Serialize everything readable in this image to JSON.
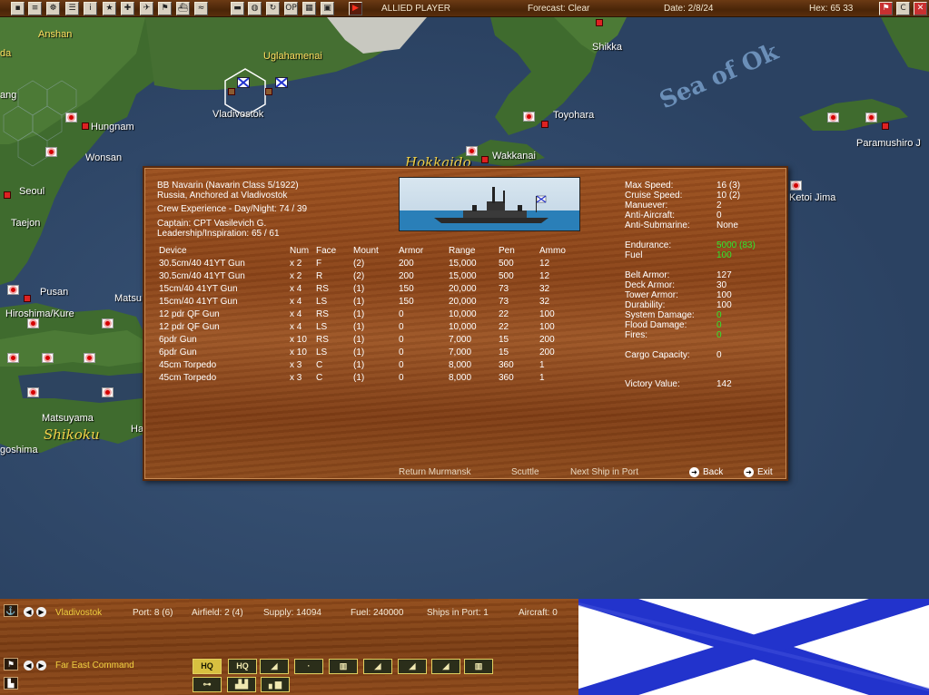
{
  "topbar": {
    "buttons": [
      "save",
      "report",
      "globe",
      "list",
      "info",
      "star",
      "plus",
      "plane",
      "flag",
      "ship",
      "wave",
      "tank",
      "earth",
      "replay",
      "op",
      "calc",
      "screen",
      "end"
    ],
    "button_glyphs": [
      "▪",
      "≡",
      "☸",
      "☰",
      "i",
      "★",
      "✚",
      "✈",
      "⚑",
      "⛴",
      "≈",
      "▬",
      "◍",
      "↻",
      "OP",
      "▦",
      "▣",
      "▶"
    ],
    "player": "ALLIED PLAYER",
    "forecast": "Forecast: Clear",
    "date": "Date: 2/8/24",
    "hex": "Hex: 65 33",
    "right_buttons": [
      "⚑",
      "C",
      "✕"
    ]
  },
  "map": {
    "labels": {
      "anshan": "Anshan",
      "da": "da",
      "yang": "ang",
      "hungnam": "Hungnam",
      "wonsan": "Wonsan",
      "seoul": "Seoul",
      "taejon": "Taejon",
      "pusan": "Pusan",
      "matsu": "Matsu",
      "hiroshima": "Hiroshima/Kure",
      "matsuyama": "Matsuyama",
      "goshima": "goshima",
      "uglahamenai": "Uglahamenai",
      "vladivostok": "Vladivostok",
      "shikka": "Shikka",
      "toyohara": "Toyohara",
      "wakkanai": "Wakkanai",
      "paramushiro": "Paramushiro J",
      "ketoi": "Ketoi Jima",
      "ha": "Ha"
    },
    "regions": {
      "hokkaido": "Hokkaido",
      "shikoku": "Shikoku",
      "sea_of_okhotsk": "Sea of Ok"
    }
  },
  "dialog": {
    "ship_title": "BB Navarin (Navarin Class 5/1922)",
    "ship_status": "Russia, Anchored at Vladivostok",
    "crew": "Crew Experience - Day/Night: 74 / 39",
    "captain": "Captain: CPT Vasilevich G.",
    "leadership": "Leadership/Inspiration: 65 / 61",
    "device_headers": [
      "Device",
      "Num",
      "Face",
      "Mount",
      "Armor",
      "Range",
      "Pen",
      "Ammo"
    ],
    "devices": [
      [
        "30.5cm/40 41YT Gun",
        "x 2",
        "F",
        "(2)",
        "200",
        "15,000",
        "500",
        "12"
      ],
      [
        "30.5cm/40 41YT Gun",
        "x 2",
        "R",
        "(2)",
        "200",
        "15,000",
        "500",
        "12"
      ],
      [
        "15cm/40 41YT Gun",
        "x 4",
        "RS",
        "(1)",
        "150",
        "20,000",
        "73",
        "32"
      ],
      [
        "15cm/40 41YT Gun",
        "x 4",
        "LS",
        "(1)",
        "150",
        "20,000",
        "73",
        "32"
      ],
      [
        "12 pdr QF Gun",
        "x 4",
        "RS",
        "(1)",
        "0",
        "10,000",
        "22",
        "100"
      ],
      [
        "12 pdr QF Gun",
        "x 4",
        "LS",
        "(1)",
        "0",
        "10,000",
        "22",
        "100"
      ],
      [
        "6pdr Gun",
        "x 10",
        "RS",
        "(1)",
        "0",
        "7,000",
        "15",
        "200"
      ],
      [
        "6pdr Gun",
        "x 10",
        "LS",
        "(1)",
        "0",
        "7,000",
        "15",
        "200"
      ],
      [
        "45cm Torpedo",
        "x 3",
        "C",
        "(1)",
        "0",
        "8,000",
        "360",
        "1"
      ],
      [
        "45cm Torpedo",
        "x 3",
        "C",
        "(1)",
        "0",
        "8,000",
        "360",
        "1"
      ]
    ],
    "stats": {
      "max_speed": {
        "label": "Max Speed:",
        "value": "16 (3)"
      },
      "cruise_speed": {
        "label": "Cruise Speed:",
        "value": "10 (2)"
      },
      "manuever": {
        "label": "Manuever:",
        "value": "2"
      },
      "anti_aircraft": {
        "label": "Anti-Aircraft:",
        "value": "0"
      },
      "anti_submarine": {
        "label": "Anti-Submarine:",
        "value": "None"
      },
      "endurance": {
        "label": "Endurance:",
        "value": "5000 (83)"
      },
      "fuel": {
        "label": "Fuel",
        "value": "100"
      },
      "belt_armor": {
        "label": "Belt Armor:",
        "value": "127"
      },
      "deck_armor": {
        "label": "Deck Armor:",
        "value": "30"
      },
      "tower_armor": {
        "label": "Tower Armor:",
        "value": "100"
      },
      "durability": {
        "label": "Durability:",
        "value": "100"
      },
      "system_damage": {
        "label": "System Damage:",
        "value": "0"
      },
      "flood_damage": {
        "label": "Flood Damage:",
        "value": "0"
      },
      "fires": {
        "label": "Fires:",
        "value": "0"
      },
      "cargo_capacity": {
        "label": "Cargo Capacity:",
        "value": "0"
      },
      "victory_value": {
        "label": "Victory Value:",
        "value": "142"
      }
    },
    "actions": {
      "return": "Return Murmansk",
      "scuttle": "Scuttle",
      "next_ship": "Next Ship in Port",
      "back": "Back",
      "exit": "Exit"
    }
  },
  "bottom": {
    "base_name": "Vladivostok",
    "port": "Port: 8 (6)",
    "airfield": "Airfield: 2 (4)",
    "supply": "Supply: 14094",
    "fuel": "Fuel: 240000",
    "ships_in_port": "Ships in Port: 1",
    "aircraft": "Aircraft: 0",
    "command": "Far East Command",
    "cmd_buttons_row1": [
      "HQ",
      "HQ",
      "◢",
      "·",
      "▥",
      "◢",
      "◢",
      "◢",
      "▥"
    ],
    "cmd_buttons_row2": [
      "⊶",
      "▟▟",
      "▖▆"
    ]
  },
  "colors": {
    "wood": "#8a4318",
    "green_value": "#2ee82e",
    "yellow_label": "#f0d040",
    "sea": "#2d4460",
    "land": "#3f6b2e",
    "st_andrew_blue": "#2233cc"
  }
}
